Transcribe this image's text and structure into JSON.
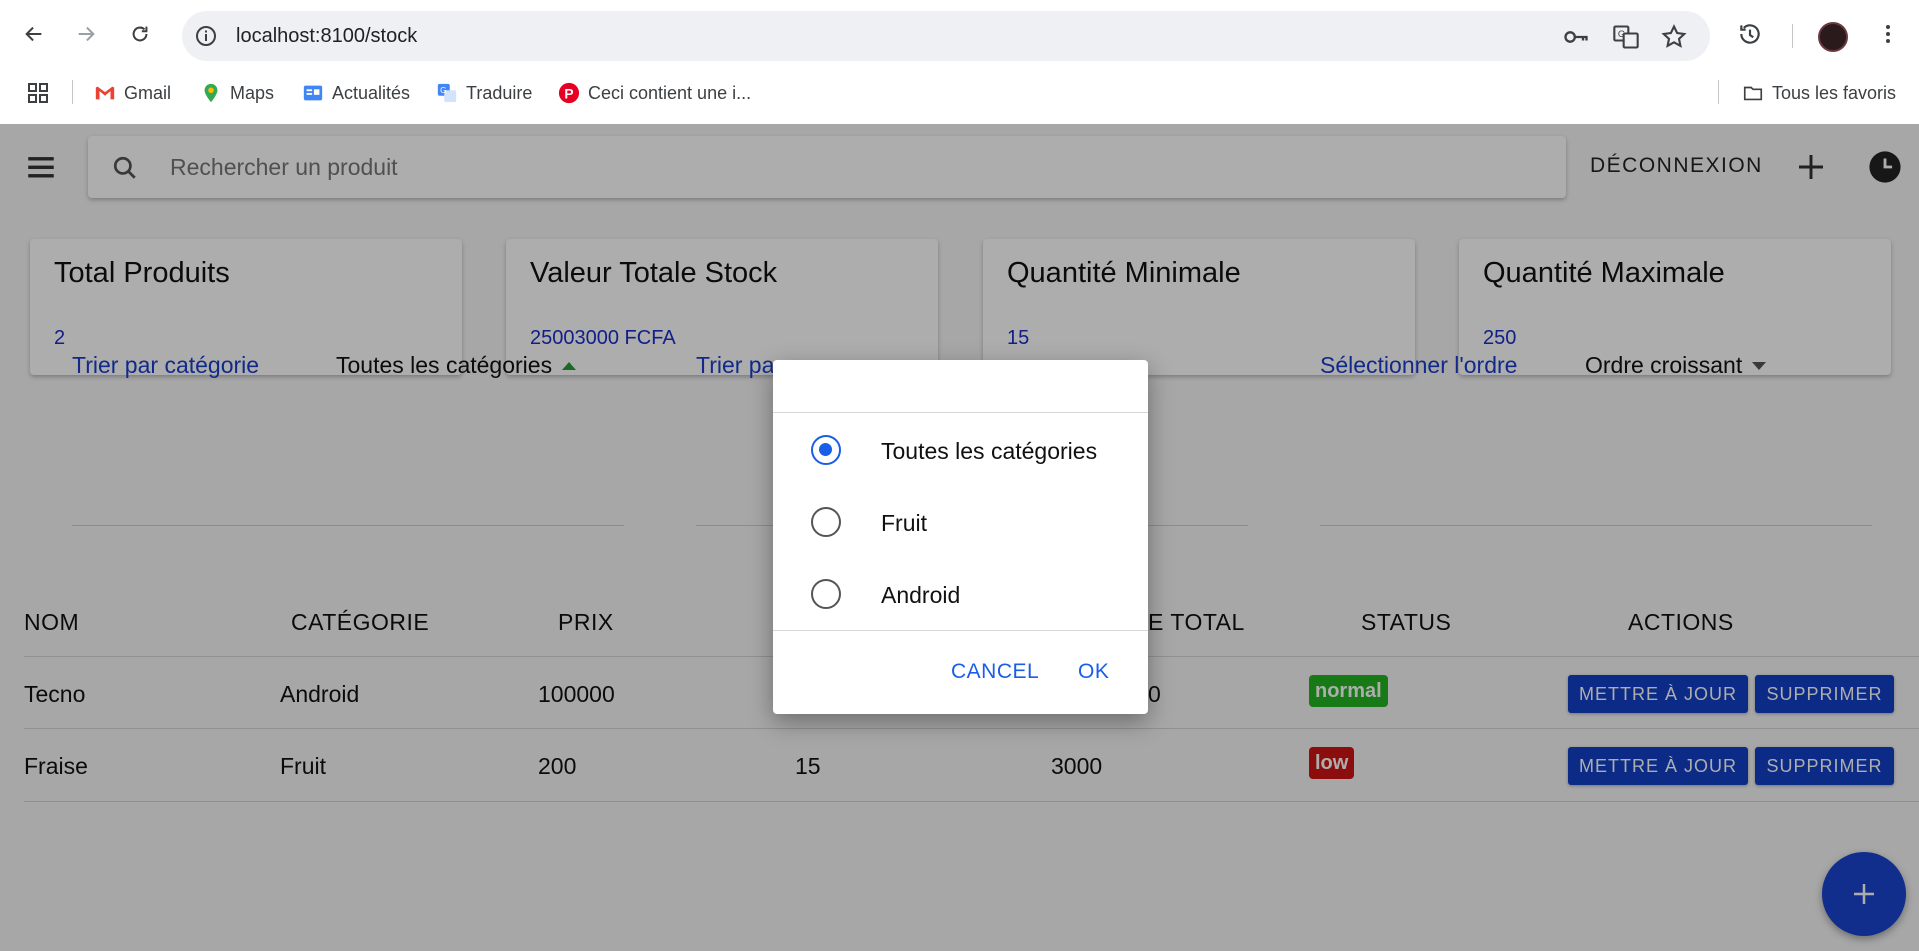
{
  "browser": {
    "url": "localhost:8100/stock",
    "bookmarks": [
      {
        "label": "Gmail",
        "icon": "gmail-icon"
      },
      {
        "label": "Maps",
        "icon": "maps-icon"
      },
      {
        "label": "Actualités",
        "icon": "news-icon"
      },
      {
        "label": "Traduire",
        "icon": "translate-icon"
      },
      {
        "label": "Ceci contient une i...",
        "icon": "pinterest-icon"
      }
    ],
    "all_bookmarks_label": "Tous les favoris"
  },
  "header": {
    "search_placeholder": "Rechercher un produit",
    "logout_label": "DÉCONNEXION"
  },
  "cards": [
    {
      "title": "Total Produits",
      "value": "2"
    },
    {
      "title": "Valeur Totale Stock",
      "value": "25003000 FCFA"
    },
    {
      "title": "Quantité Minimale",
      "value": "15"
    },
    {
      "title": "Quantité Maximale",
      "value": "250"
    }
  ],
  "filters": {
    "category_label": "Trier par catégorie",
    "category_value": "Toutes les catégories",
    "second_label_partial": "Trier pa",
    "order_label": "Sélectionner l'ordre",
    "order_value": "Ordre croissant"
  },
  "table": {
    "headers": {
      "name": "NOM",
      "category": "CATÉGORIE",
      "price": "PRIX",
      "total_partial": "E TOTAL",
      "status": "STATUS",
      "actions": "ACTIONS"
    },
    "rows": [
      {
        "name": "Tecno",
        "category": "Android",
        "price": "100000",
        "quantity": "",
        "total": "0",
        "status": "normal",
        "status_color": "#22b422"
      },
      {
        "name": "Fraise",
        "category": "Fruit",
        "price": "200",
        "quantity": "15",
        "total": "3000",
        "status": "low",
        "status_color": "#cf1414"
      }
    ],
    "update_label": "METTRE À JOUR",
    "delete_label": "SUPPRIMER"
  },
  "dialog": {
    "options": [
      {
        "label": "Toutes les catégories",
        "checked": true
      },
      {
        "label": "Fruit",
        "checked": false
      },
      {
        "label": "Android",
        "checked": false
      }
    ],
    "cancel_label": "CANCEL",
    "ok_label": "OK"
  },
  "colors": {
    "accent": "#1a5ee8",
    "primary_button": "#1340c8",
    "link_text": "#1a3ecc"
  }
}
